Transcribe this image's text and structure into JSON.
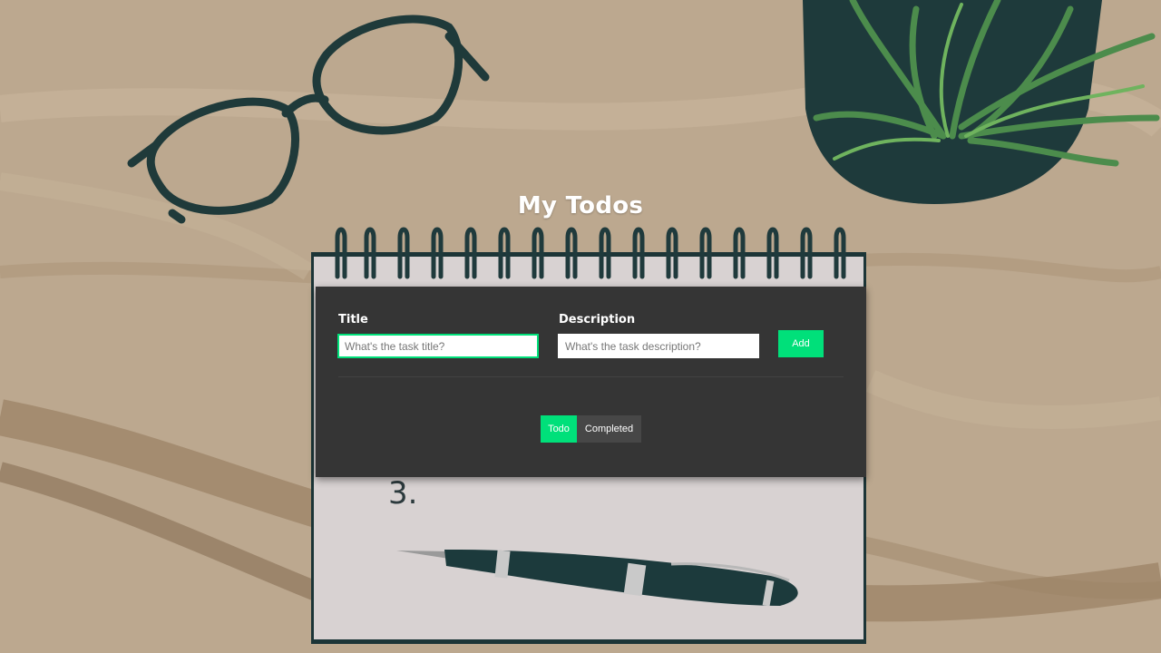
{
  "app": {
    "title": "My Todos"
  },
  "form": {
    "title_label": "Title",
    "title_placeholder": "What's the task title?",
    "title_value": "",
    "description_label": "Description",
    "description_placeholder": "What's the task description?",
    "description_value": "",
    "add_label": "Add"
  },
  "tabs": [
    {
      "label": "Todo",
      "active": true
    },
    {
      "label": "Completed",
      "active": false
    }
  ],
  "background": {
    "notebook_text": "3."
  },
  "colors": {
    "accent": "#00e07a",
    "card": "#353535",
    "inactive_tab": "#474747"
  }
}
